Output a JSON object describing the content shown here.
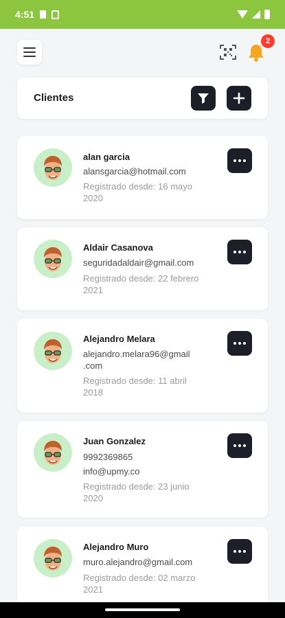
{
  "status_bar": {
    "time": "4:51"
  },
  "header": {
    "title": "Clientes"
  },
  "notifications": {
    "count": "2"
  },
  "colors": {
    "status_bar": "#8cc63f",
    "dark_button": "#1c1f27",
    "avatar_bg": "#c8efc8",
    "badge": "#ff3b30",
    "bell": "#f5a623"
  },
  "clients": [
    {
      "name": "alan garcia",
      "lines": [
        "alansgarcia@hotmail.com"
      ],
      "registered_line1": "Registrado desde: 16 mayo",
      "registered_line2": "2020"
    },
    {
      "name": "Aldair Casanova",
      "lines": [
        "seguridadaldair@gmail.com"
      ],
      "registered_line1": "Registrado desde: 22 febrero",
      "registered_line2": "2021"
    },
    {
      "name": "Alejandro Melara",
      "lines": [
        "alejandro.melara96@gmail",
        ".com"
      ],
      "registered_line1": "Registrado desde: 11 abril",
      "registered_line2": "2018"
    },
    {
      "name": "Juan Gonzalez",
      "lines": [
        "9992369865",
        "info@upmy.co"
      ],
      "registered_line1": "Registrado desde: 23 junio",
      "registered_line2": "2020"
    },
    {
      "name": "Alejandro Muro",
      "lines": [
        "muro.alejandro@gmail.com"
      ],
      "registered_line1": "Registrado desde: 02 marzo",
      "registered_line2": "2021"
    }
  ]
}
